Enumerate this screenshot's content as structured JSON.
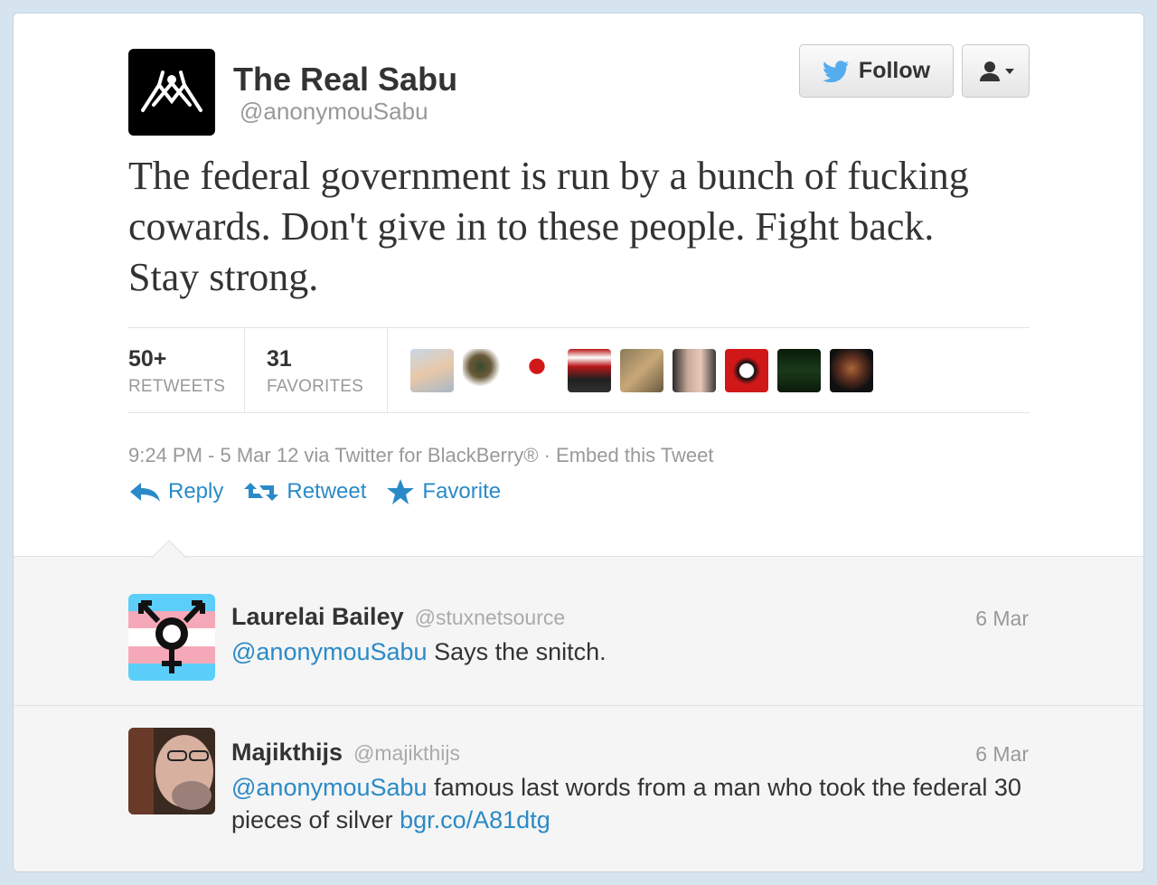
{
  "author": {
    "name": "The Real Sabu",
    "handle": "@anonymouSabu"
  },
  "buttons": {
    "follow_label": "Follow"
  },
  "tweet": {
    "text": "The federal government is run by a bunch of fucking cowards. Don't give in to these people. Fight back. Stay strong."
  },
  "stats": {
    "retweets_count": "50+",
    "retweets_label": "RETWEETS",
    "favorites_count": "31",
    "favorites_label": "FAVORITES"
  },
  "meta": {
    "timestamp": "9:24 PM - 5 Mar 12 via Twitter for BlackBerry® · Embed this Tweet"
  },
  "actions": {
    "reply": "Reply",
    "retweet": "Retweet",
    "favorite": "Favorite"
  },
  "replies": [
    {
      "name": "Laurelai Bailey",
      "handle": "@stuxnetsource",
      "time": "6 Mar",
      "mention": "@anonymouSabu",
      "text": " Says the snitch."
    },
    {
      "name": "Majikthijs",
      "handle": "@majikthijs",
      "time": "6 Mar",
      "mention": "@anonymouSabu",
      "text": " famous last words from a man who took the federal 30 pieces of silver ",
      "link": "bgr.co/A81dtg"
    }
  ],
  "colors": {
    "link": "#2a8ac7",
    "background": "#d5e4ee",
    "muted": "#999999"
  }
}
